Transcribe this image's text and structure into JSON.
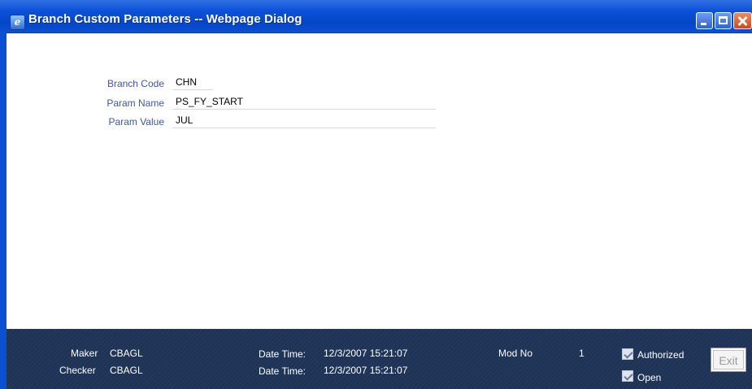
{
  "window": {
    "title": "Branch Custom Parameters -- Webpage Dialog",
    "app_icon": "ie-icon",
    "minimize_icon": "minimize-icon",
    "maximize_icon": "maximize-icon",
    "close_icon": "close-icon"
  },
  "form": {
    "branch_code": {
      "label": "Branch Code",
      "value": "CHN"
    },
    "param_name": {
      "label": "Param Name",
      "value": "PS_FY_START"
    },
    "param_value": {
      "label": "Param Value",
      "value": "JUL"
    }
  },
  "footer": {
    "maker_label": "Maker",
    "maker_value": "CBAGL",
    "checker_label": "Checker",
    "checker_value": "CBAGL",
    "maker_datetime_label": "Date Time:",
    "maker_datetime_value": "12/3/2007 15:21:07",
    "checker_datetime_label": "Date Time:",
    "checker_datetime_value": "12/3/2007 15:21:07",
    "mod_no_label": "Mod No",
    "mod_no_value": "1",
    "authorized_label": "Authorized",
    "authorized_checked": true,
    "open_label": "Open",
    "open_checked": true,
    "exit_label": "Exit"
  },
  "colors": {
    "titlebar": "#0a51d8",
    "footer": "#1e3253",
    "field_label": "#3d57a8"
  }
}
